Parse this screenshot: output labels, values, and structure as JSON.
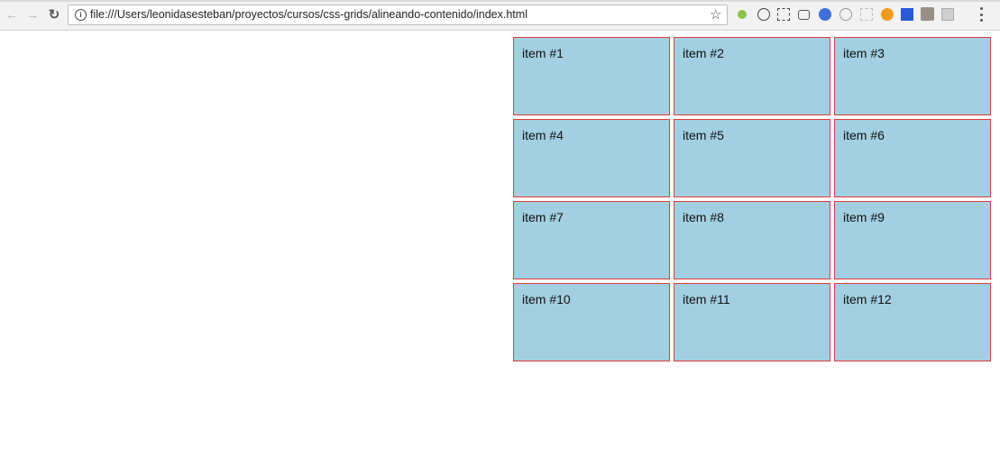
{
  "browser": {
    "url": "file:///Users/leonidasesteban/proyectos/cursos/css-grids/alineando-contenido/index.html",
    "nav": {
      "back_icon": "back-arrow-icon",
      "forward_icon": "forward-arrow-icon",
      "reload_icon": "reload-icon"
    },
    "extensions": [
      "bookmark-star-icon",
      "android-icon",
      "info-extension-icon",
      "capture-icon",
      "camera-icon",
      "blue-dot-icon",
      "play-circle-icon",
      "dashed-square-icon",
      "orange-play-icon",
      "blue-flag-icon",
      "puzzle-badge-icon",
      "grey-box-icon",
      "menu-dots-icon"
    ]
  },
  "grid": {
    "items": [
      {
        "label": "item #1"
      },
      {
        "label": "item #2"
      },
      {
        "label": "item #3"
      },
      {
        "label": "item #4"
      },
      {
        "label": "item #5"
      },
      {
        "label": "item #6"
      },
      {
        "label": "item #7"
      },
      {
        "label": "item #8"
      },
      {
        "label": "item #9"
      },
      {
        "label": "item #10"
      },
      {
        "label": "item #11"
      },
      {
        "label": "item #12"
      }
    ]
  },
  "colors": {
    "item_bg": "#a2d0e2",
    "item_border": "#e03a3a",
    "toolbar_bg": "#f2f2f2"
  }
}
